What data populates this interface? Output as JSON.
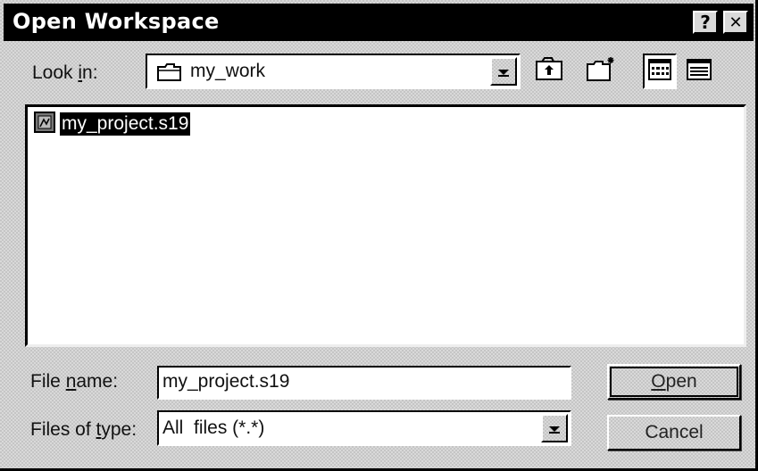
{
  "window": {
    "title": "Open Workspace",
    "help_glyph": "?",
    "close_glyph": "✕"
  },
  "look_in": {
    "label_pre": "Look ",
    "label_accel": "i",
    "label_post": "n:",
    "value": "my_work"
  },
  "toolbar": {
    "icons": [
      "up-one-level-icon",
      "create-new-folder-icon",
      "list-view-icon",
      "details-view-icon"
    ]
  },
  "file_list": {
    "items": [
      {
        "name": "my_project.s19",
        "selected": true
      }
    ]
  },
  "file_name": {
    "label_pre": "File ",
    "label_accel": "n",
    "label_post": "ame:",
    "value": "my_project.s19"
  },
  "file_type": {
    "label_pre": "Files of ",
    "label_accel": "t",
    "label_post": "ype:",
    "value": "All  files (*.*)"
  },
  "buttons": {
    "open_accel": "O",
    "open_rest": "pen",
    "cancel": "Cancel"
  },
  "colors": {
    "titlebar": "#000000",
    "face": "#d9d9d9",
    "selection": "#000000"
  }
}
